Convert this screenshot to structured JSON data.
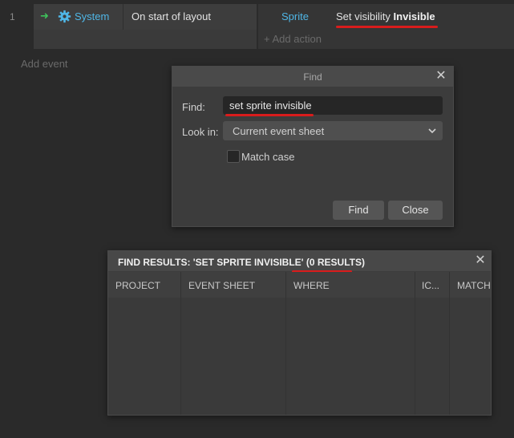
{
  "event_sheet": {
    "event_number": "1",
    "condition": {
      "object": "System",
      "text": "On start of layout"
    },
    "action": {
      "object": "Sprite",
      "text_prefix": "Set visibility ",
      "text_bold": "Invisible"
    },
    "add_action": "Add action",
    "add_event": "Add event"
  },
  "find_dialog": {
    "title": "Find",
    "close_symbol": "✕",
    "find_label": "Find:",
    "find_value": "set sprite invisible",
    "lookin_label": "Look in:",
    "lookin_value": "Current event sheet",
    "match_case_label": "Match case",
    "match_case_checked": false,
    "find_button": "Find",
    "close_button": "Close"
  },
  "find_results": {
    "title_prefix": "FIND RESULTS: 'SET SPRITE INVISIBLE' ",
    "title_count": "(0 RESULTS)",
    "close_symbol": "✕",
    "columns": [
      "PROJECT",
      "EVENT SHEET",
      "WHERE",
      "IC...",
      "MATCH"
    ]
  },
  "colors": {
    "accent_blue": "#4fb6e6",
    "trigger_green": "#3ec15a",
    "annotation_red": "#d91c1c"
  }
}
